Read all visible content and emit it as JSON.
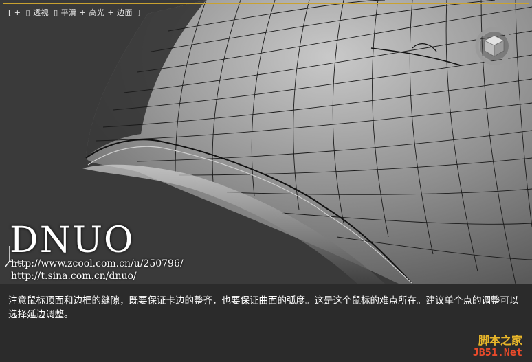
{
  "viewport": {
    "label_parts": [
      "[ + ",
      "▯ 透视",
      "▯ 平滑 + 高光 + 边面",
      " ]"
    ],
    "frame_color": "#c9a230",
    "icons": [
      "viewcube-icon",
      "axis-gizmo-icon"
    ]
  },
  "watermark": {
    "brand": "DNUO",
    "url1": "http://www.zcool.com.cn/u/250796/",
    "url2": "http://t.sina.com.cn/dnuo/"
  },
  "caption": {
    "text": "注意鼠标顶面和边框的缝隙，既要保证卡边的整齐，也要保证曲面的弧度。这是这个鼠标的难点所在。建议单个点的调整可以选择延边调整。"
  },
  "site_logo": {
    "cn": "脚本之家",
    "en": "JB51.Net"
  }
}
